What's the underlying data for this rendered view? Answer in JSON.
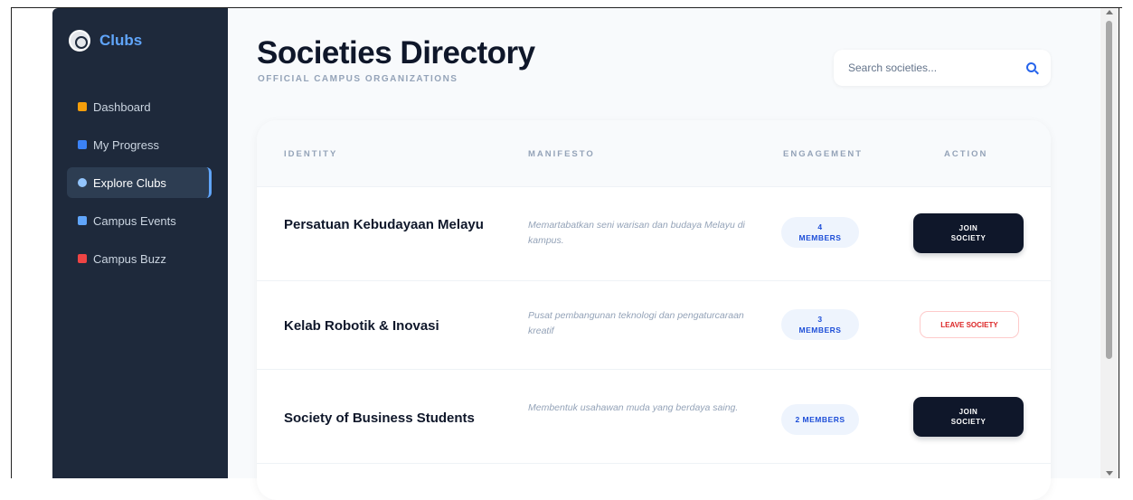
{
  "brand": {
    "name": "Clubs",
    "logo_icon": "university-seal-icon"
  },
  "sidebar": {
    "items": [
      {
        "label": "Dashboard",
        "icon": "house-icon",
        "icon_color": "#f59e0b",
        "active": false
      },
      {
        "label": "My Progress",
        "icon": "bar-chart-icon",
        "icon_color": "#3b82f6",
        "active": false
      },
      {
        "label": "Explore Clubs",
        "icon": "magnifier-icon",
        "icon_color": "#60a5fa",
        "active": true
      },
      {
        "label": "Campus Events",
        "icon": "calendar-icon",
        "icon_color": "#60a5fa",
        "active": false
      },
      {
        "label": "Campus Buzz",
        "icon": "megaphone-icon",
        "icon_color": "#ef4444",
        "active": false
      }
    ]
  },
  "header": {
    "title": "Societies Directory",
    "subtitle": "OFFICIAL CAMPUS ORGANIZATIONS"
  },
  "search": {
    "placeholder": "Search societies..."
  },
  "table": {
    "columns": [
      "IDENTITY",
      "MANIFESTO",
      "ENGAGEMENT",
      "ACTION"
    ],
    "rows": [
      {
        "name": "Persatuan Kebudayaan Melayu",
        "manifesto": "Memartabatkan seni warisan dan budaya Melayu di kampus.",
        "engagement": "4 MEMBERS",
        "action": "JOIN SOCIETY",
        "action_type": "join"
      },
      {
        "name": "Kelab Robotik & Inovasi",
        "manifesto": "Pusat pembangunan teknologi dan pengaturcaraan kreatif",
        "engagement": "3 MEMBERS",
        "action": "LEAVE SOCIETY",
        "action_type": "leave"
      },
      {
        "name": "Society of Business Students",
        "manifesto": "Membentuk usahawan muda yang berdaya saing.",
        "engagement": "2 MEMBERS",
        "action": "JOIN SOCIETY",
        "action_type": "join"
      }
    ]
  },
  "colors": {
    "sidebar_bg": "#1e293b",
    "brand_accent": "#60a5fa",
    "primary_dark": "#0f172a",
    "leave_red": "#dc2626",
    "badge_text": "#1d4ed8"
  }
}
